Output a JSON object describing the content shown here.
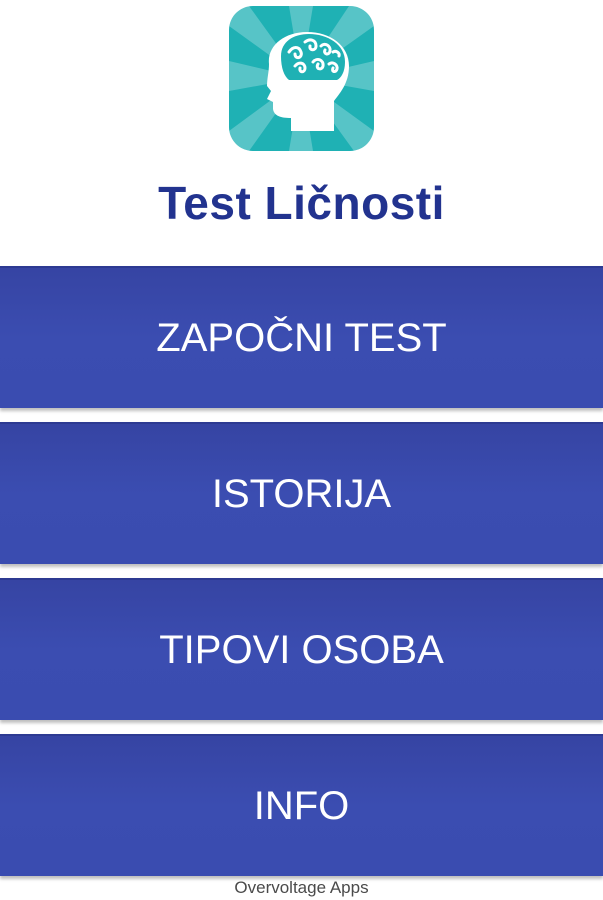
{
  "app": {
    "title": "Test Ličnosti",
    "logo_icon": "head-brain-icon"
  },
  "menu": {
    "items": [
      {
        "label": "ZAPOČNI TEST"
      },
      {
        "label": "ISTORIJA"
      },
      {
        "label": "TIPOVI OSOBA"
      },
      {
        "label": "INFO"
      }
    ]
  },
  "footer": {
    "text": "Overvoltage Apps"
  },
  "colors": {
    "title": "#22338f",
    "button": "#3b4db1",
    "logo_background": "#1fb1b4"
  }
}
